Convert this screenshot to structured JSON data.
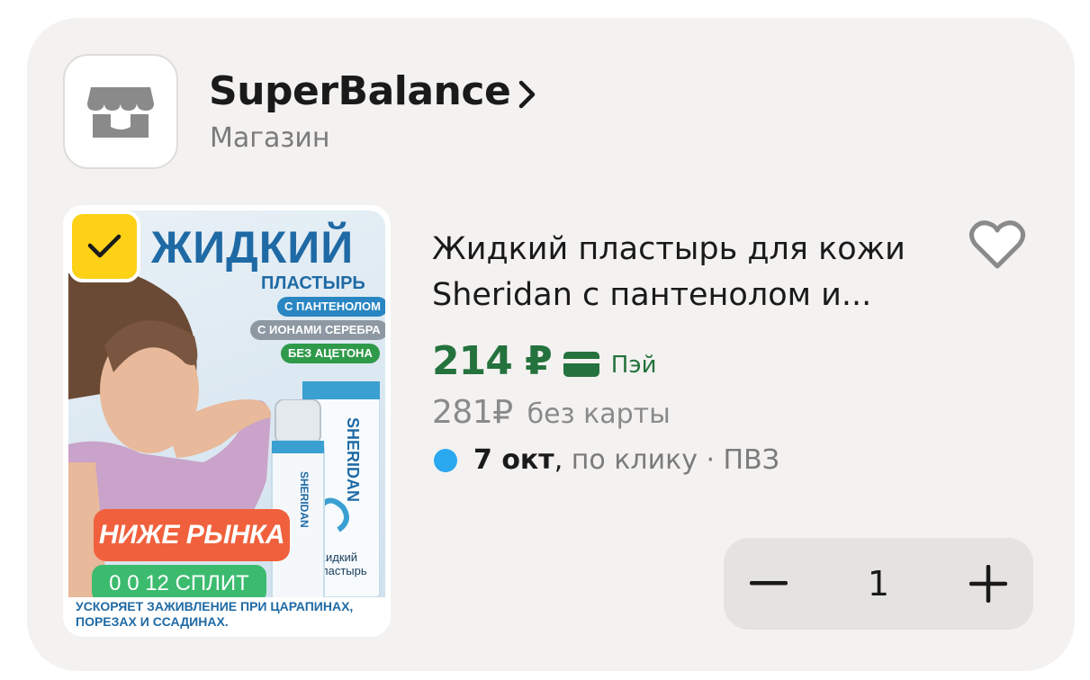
{
  "store": {
    "name": "SuperBalance",
    "type": "Магазин",
    "logo_icon": "storefront-icon",
    "chevron_icon": "chevron-right-icon"
  },
  "product": {
    "title_line1": "Жидкий пластырь для кожи",
    "title_line2": "Sheridan с пантенолом и...",
    "selected": true,
    "favorite": false,
    "image": {
      "headline": "ЖИДКИЙ",
      "subheadline": "ПЛАСТЫРЬ",
      "pill_1": "С ПАНТЕНОЛОМ",
      "pill_2": "С ИОНАМИ СЕРЕБРА",
      "pill_3": "БЕЗ АЦЕТОНА",
      "badge_market": "НИЖЕ РЫНКА",
      "badge_split": "0 0 12 СПЛИТ",
      "footer_line1": "УСКОРЯЕТ ЗАЖИВЛЕНИЕ ПРИ ЦАРАПИНАХ,",
      "footer_line2": "ПОРЕЗАХ И ССАДИНАХ.",
      "brand": "SHERIDAN"
    },
    "price": {
      "main": "214 ₽",
      "pay_label": "Пэй",
      "old": "281₽",
      "old_label": "без карты"
    },
    "delivery": {
      "date": "7 окт",
      "comma": ",",
      "rest": " по клику · ПВЗ"
    }
  },
  "stepper": {
    "quantity": "1",
    "minus_icon": "minus-icon",
    "plus_icon": "plus-icon"
  },
  "colors": {
    "price_green": "#24723d",
    "check_yellow": "#fcd116",
    "delivery_dot": "#2aa8f0",
    "badge_orange": "#f0603c",
    "badge_green": "#3cbb6f"
  }
}
